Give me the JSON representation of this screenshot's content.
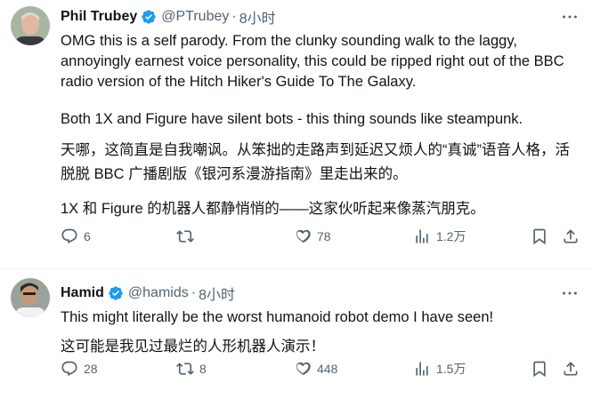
{
  "tweets": [
    {
      "name": "Phil Trubey",
      "handle": "@PTrubey",
      "dot": "·",
      "time": "8小时",
      "paragraphs": [
        "OMG this is a self parody. From the clunky sounding walk to the laggy, annoyingly earnest voice personality, this could be ripped right out of the BBC radio version of the Hitch Hiker's Guide To The Galaxy.",
        "Both 1X and Figure have silent bots - this thing sounds like steampunk.",
        "天哪，这简直是自我嘲讽。从笨拙的走路声到延迟又烦人的“真诚”语音人格，活脱脱 BBC 广播剧版《银河系漫游指南》里走出来的。",
        "1X 和 Figure 的机器人都静悄悄的——这家伙听起来像蒸汽朋克。"
      ],
      "replies": "6",
      "retweets": "",
      "likes": "78",
      "views": "1.2万"
    },
    {
      "name": "Hamid",
      "handle": "@hamids",
      "dot": "·",
      "time": "8小时",
      "paragraphs": [
        "This might literally be the worst humanoid robot demo I have seen!",
        "这可能是我见过最烂的人形机器人演示！"
      ],
      "replies": "28",
      "retweets": "8",
      "likes": "448",
      "views": "1.5万"
    }
  ],
  "colors": {
    "verified": "#1d9bf0",
    "muted": "#536471",
    "text": "#0f1419"
  },
  "icons": [
    "verified-badge-icon",
    "more-icon",
    "reply-icon",
    "retweet-icon",
    "like-icon",
    "views-icon",
    "bookmark-icon",
    "share-icon"
  ]
}
